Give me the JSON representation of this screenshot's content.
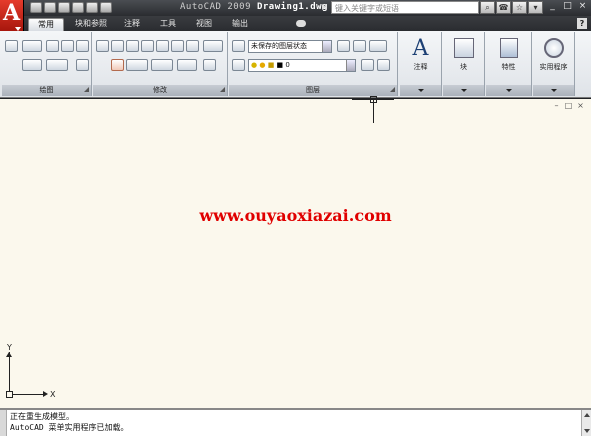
{
  "title_bar": {
    "app": "AutoCAD 2009",
    "document": "Drawing1.dwg",
    "search_placeholder": "键入关键字或短语",
    "buttons": [
      "search-icon",
      "subscription-icon",
      "favorites-icon",
      "help-icon"
    ],
    "window_controls": [
      "_",
      "□",
      "×"
    ]
  },
  "tabs": [
    "常用",
    "块和参照",
    "注释",
    "工具",
    "视图",
    "输出"
  ],
  "active_tab": "常用",
  "help_label": "?",
  "ribbon": {
    "panels": [
      {
        "id": "draw",
        "title": "绘图"
      },
      {
        "id": "modify",
        "title": "修改"
      },
      {
        "id": "layers",
        "title": "图层"
      }
    ],
    "layer_combo": "未保存的图层状态",
    "layer_current": "0",
    "big_buttons": [
      {
        "id": "annotation",
        "label": "注释",
        "glyph": "A"
      },
      {
        "id": "block",
        "label": "块",
        "glyph": "block-icon"
      },
      {
        "id": "properties",
        "label": "特性",
        "glyph": "properties-icon"
      },
      {
        "id": "utilities",
        "label": "实用程序",
        "glyph": "utilities-icon"
      }
    ]
  },
  "viewport_controls": [
    "–",
    "□",
    "×"
  ],
  "watermark": "www.ouyaoxiazai.com",
  "ucs": {
    "x_label": "X",
    "y_label": "Y"
  },
  "command_window": {
    "lines": [
      "正在重生成模型。",
      "AutoCAD 菜单实用程序已加载。"
    ]
  },
  "colors": {
    "accent_red": "#c8261a",
    "canvas_bg": "#fbf8ed",
    "watermark": "#e00000"
  }
}
